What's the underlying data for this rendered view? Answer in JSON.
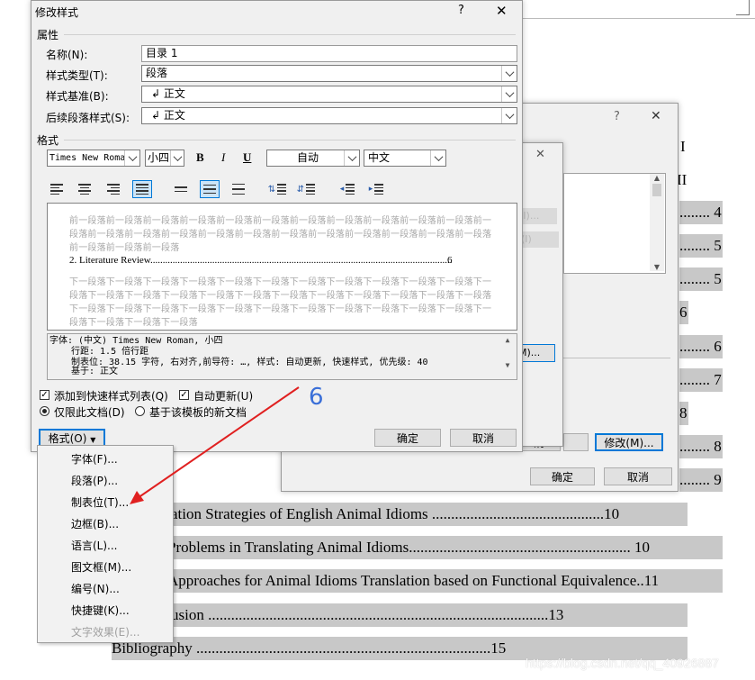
{
  "document": {
    "roman_labels": [
      "I",
      "II"
    ],
    "toc_lines": [
      {
        "text": "ation Strategies of English Animal Idioms .............................................10"
      },
      {
        "text": " Problems in Translating Animal Idioms.......................................................... 10"
      },
      {
        "text": " Approaches for Animal Idioms Translation based on Functional Equivalence..11"
      },
      {
        "text": "usion .........................................................................................13"
      },
      {
        "text": "Bibliography .............................................................................15"
      }
    ],
    "right_entries": [
      "........ 4",
      "........ 5",
      "........ 5",
      "6",
      "........ 6",
      "........ 7",
      "8",
      "........ 8",
      "........ 9"
    ]
  },
  "back_dialog": {
    "help": "?",
    "close": "✕",
    "ok_label": "确定",
    "cancel_label": "取消",
    "modify_label": "修改(M)...",
    "partial_cancel": "消",
    "side_label": "样",
    "faint_btn1": "(I)...",
    "faint_btn2": "(I)"
  },
  "mid_dialog": {
    "close": "✕"
  },
  "dialog": {
    "title": "修改样式",
    "help": "?",
    "close": "✕",
    "properties_group": "属性",
    "name_label": "名称(N):",
    "name_value": "目录 1",
    "style_type_label": "样式类型(T):",
    "style_type_value": "段落",
    "style_based_label": "样式基准(B):",
    "style_based_value": "↲ 正文",
    "next_style_label": "后续段落样式(S):",
    "next_style_value": "↲ 正文",
    "format_group": "格式",
    "font_value": "Times New Roma",
    "size_value": "小四",
    "bold": "B",
    "italic": "I",
    "underline": "U",
    "color_value": "自动",
    "lang_value": "中文",
    "preview": {
      "prev_text": "前一段落前一段落前一段落前一段落前一段落前一段落前一段落前一段落前一段落前一段落前一段落前一段落前一段落前一段落前一段落前一段落前一段落前一段落前一段落前一段落前一段落前一段落前一段落前一段落前一段落前一段落",
      "sample": "2. Literature Review",
      "sample_page": "6",
      "next_text": "下一段落下一段落下一段落下一段落下一段落下一段落下一段落下一段落下一段落下一段落下一段落下一段落下一段落下一段落下一段落下一段落下一段落下一段落下一段落下一段落下一段落下一段落下一段落下一段落下一段落下一段落下一段落下一段落下一段落下一段落下一段落下一段落下一段落下一段落下一段落下一段落下一段落下一段落"
    },
    "description": {
      "line1": "字体: (中文) Times New Roman, 小四",
      "line2": "行距: 1.5 倍行距",
      "line3": "制表位:  38.15 字符, 右对齐,前导符: …, 样式: 自动更新, 快速样式, 优先级: 40",
      "line4": "基于: 正文"
    },
    "add_quick_style": "添加到快速样式列表(Q)",
    "auto_update": "自动更新(U)",
    "only_this_doc": "仅限此文档(D)",
    "new_docs_template": "基于该模板的新文档",
    "format_button": "格式(O)",
    "ok_label": "确定",
    "cancel_label": "取消"
  },
  "format_menu": {
    "items": [
      {
        "label": "字体(F)..."
      },
      {
        "label": "段落(P)..."
      },
      {
        "label": "制表位(T)..."
      },
      {
        "label": "边框(B)..."
      },
      {
        "label": "语言(L)..."
      },
      {
        "label": "图文框(M)..."
      },
      {
        "label": "编号(N)..."
      },
      {
        "label": "快捷键(K)..."
      },
      {
        "label": "文字效果(E)..."
      }
    ]
  },
  "annotation": {
    "number": "6",
    "arrow_color": "#e02020",
    "number_color": "#3a6fd8"
  },
  "watermark": "https://blog.csdn.net/qq_40926887"
}
